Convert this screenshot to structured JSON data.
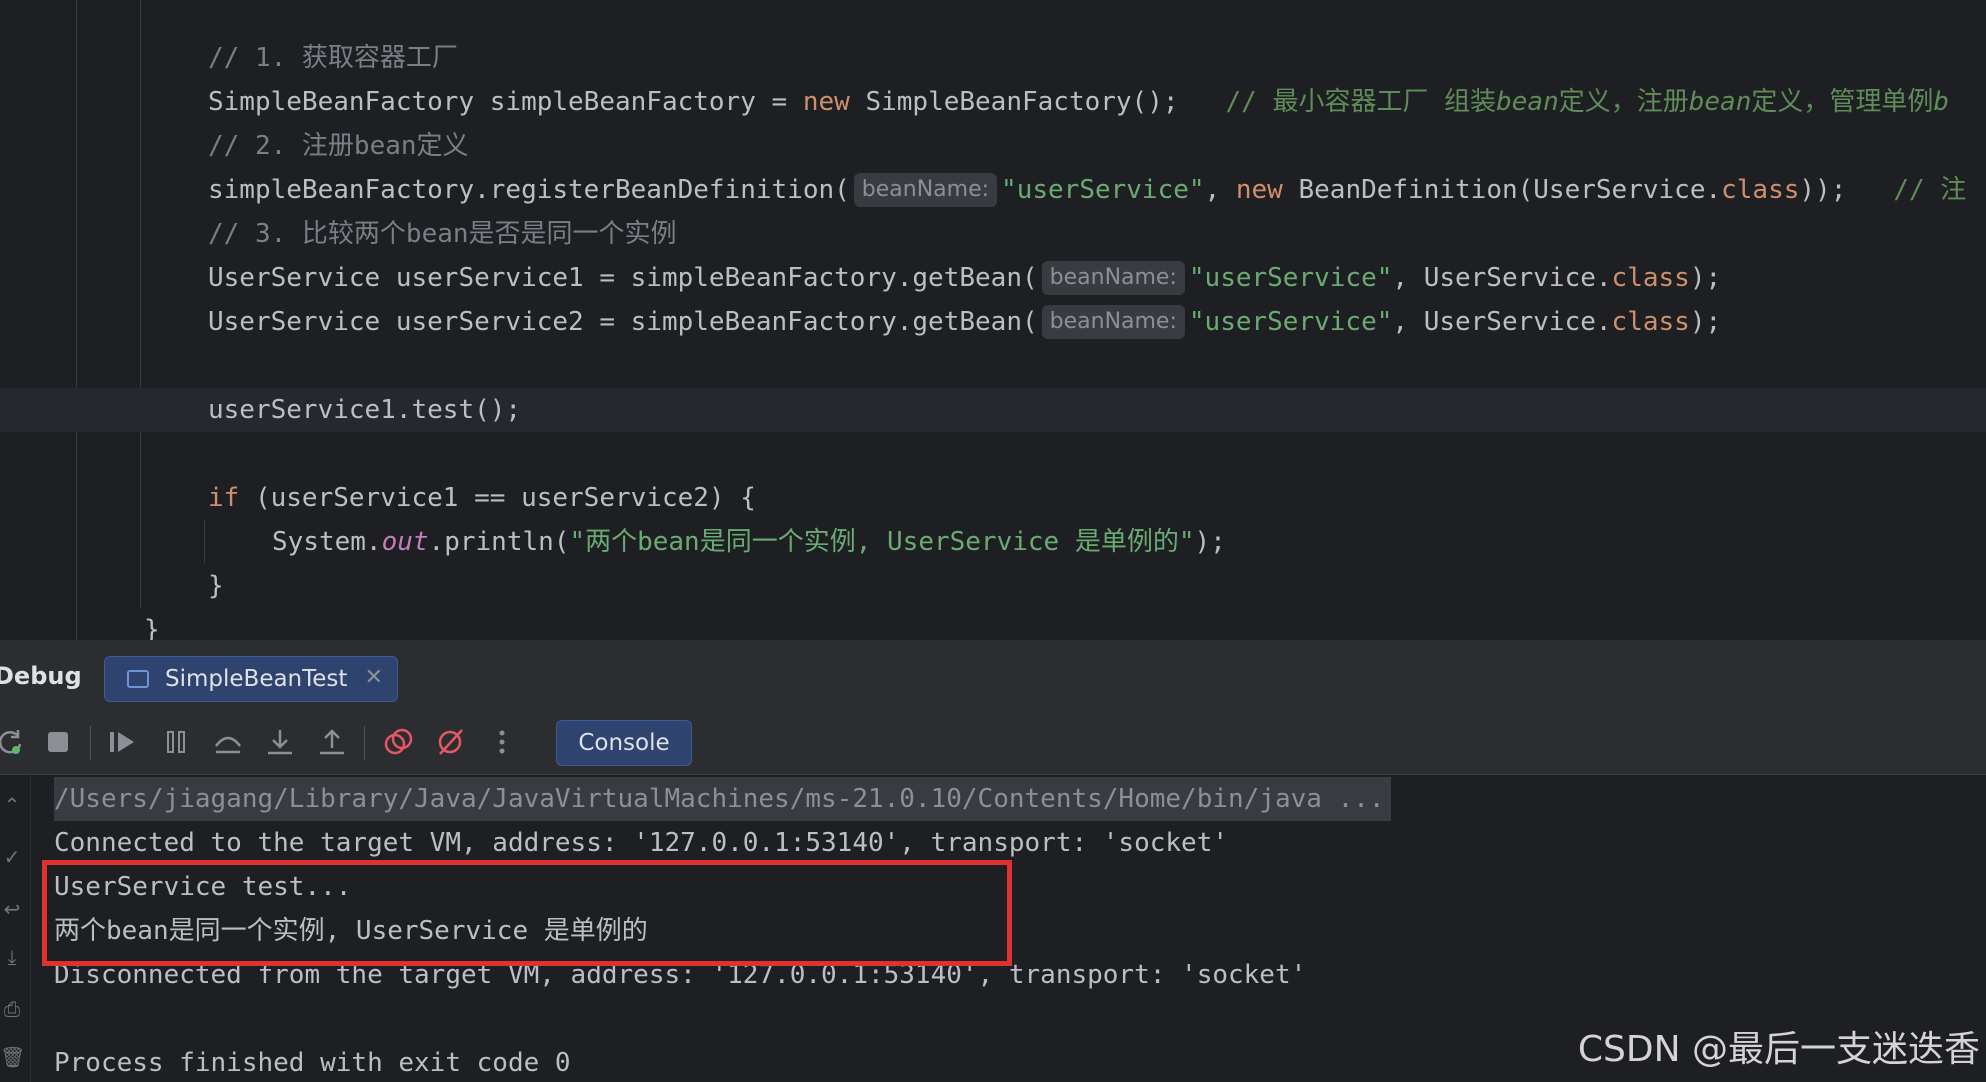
{
  "editor": {
    "line1_comment": "// 1. 获取容器工厂",
    "line2": {
      "type": "SimpleBeanFactory simpleBeanFactory = ",
      "kw_new": "new",
      "call": " SimpleBeanFactory();   ",
      "comment_prefix": "// 最小容器工厂 组装",
      "comment_bean1": "bean",
      "comment_mid": "定义，注册",
      "comment_bean2": "bean",
      "comment_tail": "定义，管理单例",
      "comment_bean3": "b"
    },
    "line3_comment": "// 2. 注册bean定义",
    "line4": {
      "call": "simpleBeanFactory.registerBeanDefinition(",
      "hint": "beanName:",
      "str": "\"userService\"",
      "comma": ", ",
      "kw_new": "new",
      "ctor": " BeanDefinition(UserService.",
      "kw_class": "class",
      "end": "));   ",
      "comment": "// 注"
    },
    "line5_comment": "// 3. 比较两个bean是否是同一个实例",
    "line6": {
      "decl": "UserService userService1 = simpleBeanFactory.getBean(",
      "hint": "beanName:",
      "str": "\"userService\"",
      "mid": ", UserService.",
      "kw_class": "class",
      "end": ");"
    },
    "line7": {
      "decl": "UserService userService2 = simpleBeanFactory.getBean(",
      "hint": "beanName:",
      "str": "\"userService\"",
      "mid": ", UserService.",
      "kw_class": "class",
      "end": ");"
    },
    "line9": "userService1.test();",
    "line11": {
      "kw_if": "if",
      "cond": " (userService1 == userService2) {"
    },
    "line12": {
      "pre": "System.",
      "field": "out",
      "mid": ".println(",
      "str": "\"两个bean是同一个实例, UserService 是单例的\"",
      "end": ");"
    },
    "line13": "}",
    "line14": "}"
  },
  "debug": {
    "title": "Debug",
    "tab_label": "SimpleBeanTest",
    "tab_close": "✕",
    "console_button": "Console",
    "toolbar_icons": [
      "rerun-icon",
      "stop-icon",
      "resume-icon",
      "pause-icon",
      "step-over-icon",
      "step-into-icon",
      "step-out-icon",
      "view-breakpoints-icon",
      "mute-breakpoints-icon",
      "more-icon"
    ]
  },
  "console": {
    "lines": [
      "/Users/jiagang/Library/Java/JavaVirtualMachines/ms-21.0.10/Contents/Home/bin/java ...",
      "Connected to the target VM, address: '127.0.0.1:53140', transport: 'socket'",
      "UserService test...",
      "两个bean是同一个实例, UserService 是单例的",
      "Disconnected from the target VM, address: '127.0.0.1:53140', transport: 'socket'",
      "",
      "Process finished with exit code 0"
    ]
  },
  "watermark": "CSDN @最后一支迷迭香",
  "colors": {
    "background": "#1e1f22",
    "keyword": "#cf8e6d",
    "string": "#6aab73",
    "comment": "#7a7e85",
    "highlight_box": "#e03131",
    "accent_tab": "#2e436e"
  }
}
